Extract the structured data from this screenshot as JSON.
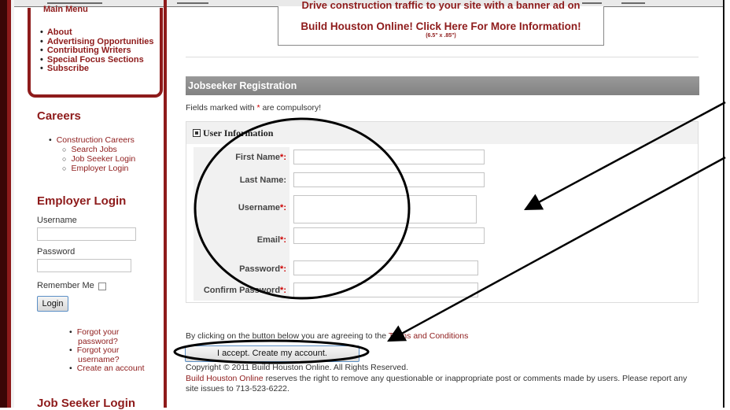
{
  "sidebar": {
    "menu_truncated": "Main Menu",
    "menu": [
      "About",
      "Advertising Opportunities",
      "Contributing Writers",
      "Special Focus Sections",
      "Subscribe"
    ],
    "careers_title": "Careers",
    "careers": {
      "parent": "Construction Careers",
      "children": [
        "Search Jobs",
        "Job Seeker Login",
        "Employer Login"
      ]
    },
    "employer_login_title": "Employer Login",
    "username_label": "Username",
    "password_label": "Password",
    "remember_label": "Remember Me",
    "login_button": "Login",
    "forgot_password": [
      "Forgot your",
      "password?"
    ],
    "forgot_username": [
      "Forgot your",
      "username?"
    ],
    "create_account": "Create an account",
    "job_seeker_login_title": "Job Seeker Login"
  },
  "banner": {
    "cut_text": "Drive construction traffic to your site with a banner ad on",
    "title": "Build Houston Online! Click Here For More Information!",
    "size": "(6.5\" x .85\")"
  },
  "main": {
    "section_title": "Jobseeker Registration",
    "note_prefix": "Fields marked with ",
    "note_star": "*",
    "note_suffix": " are compulsory!",
    "legend": "User Information",
    "fields": [
      {
        "label": "First Name",
        "required": "*:"
      },
      {
        "label": "Last Name:",
        "required": ""
      },
      {
        "label": "Username",
        "required": "*:"
      },
      {
        "label": "Email",
        "required": "*:"
      },
      {
        "label": "Password",
        "required": "*:"
      },
      {
        "label": "Confirm Password",
        "required": "*:"
      }
    ],
    "terms_prefix": "By clicking on the button below you are agreeing to the ",
    "terms_link": "Terms and Conditions",
    "accept_button": "I accept. Create my account.",
    "copyright": "Copyright © 2011 Build Houston Online. All Rights Reserved.",
    "disclaimer_link": "Build Houston Online",
    "disclaimer_text": " reserves the right to remove any questionable or inappropriate post or comments made by users. Please report any site issues to 713-523-6222."
  },
  "colors": {
    "brand_red": "#8e1b1b",
    "header_gray": "#8e8e8e",
    "required_star": "#cc0000",
    "annotation": "#000000"
  }
}
